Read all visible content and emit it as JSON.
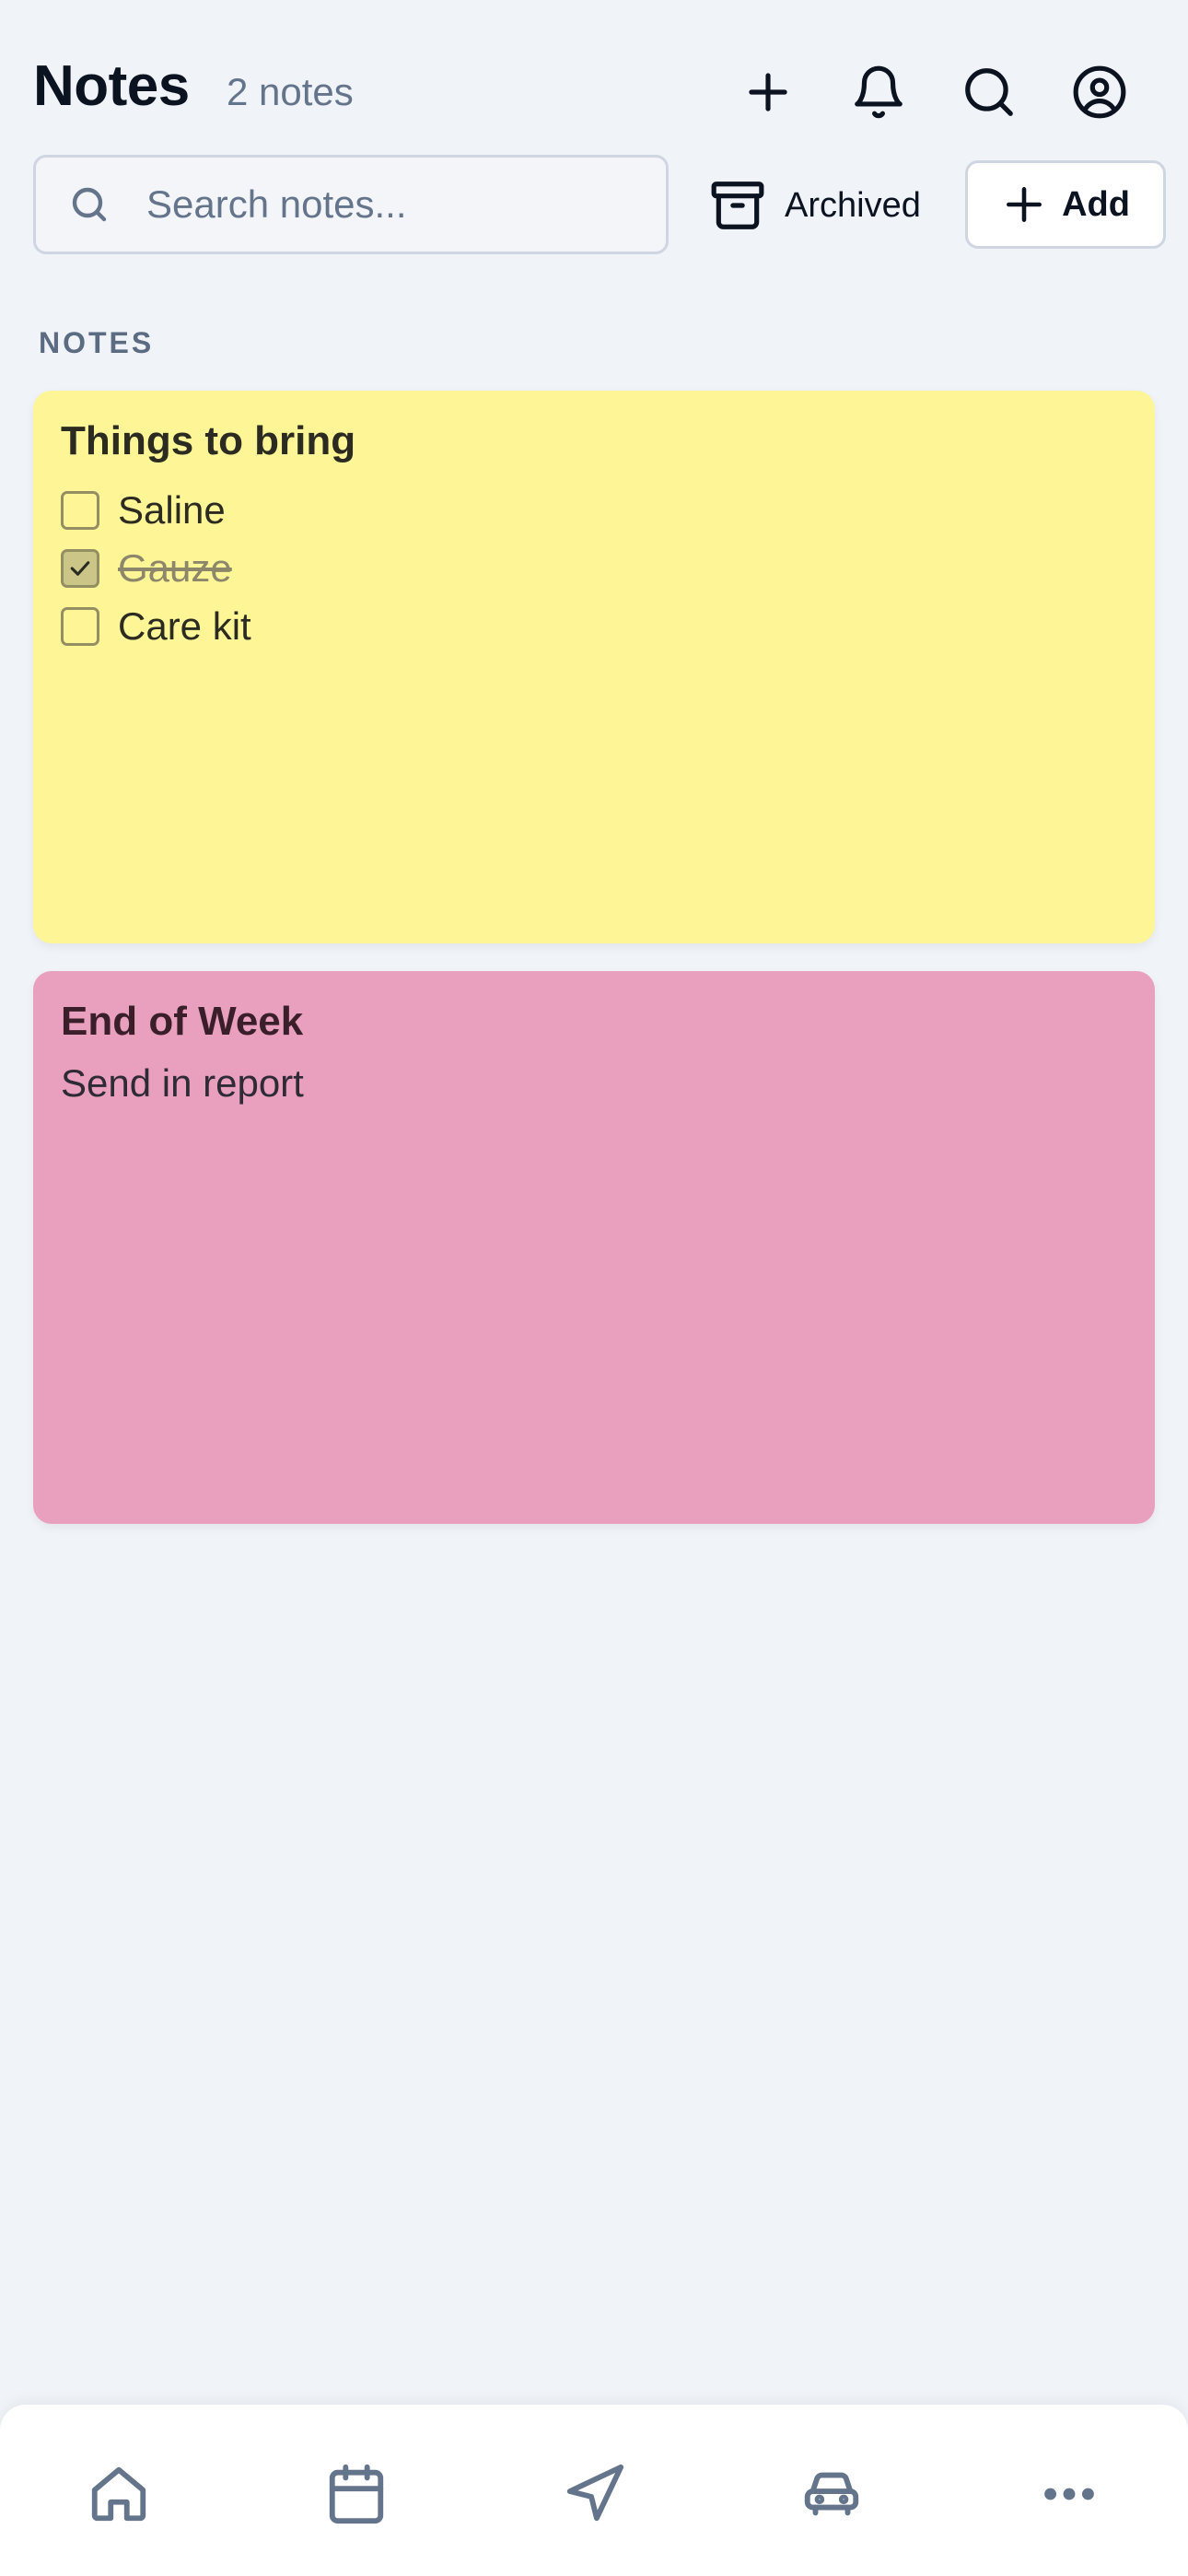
{
  "header": {
    "title": "Notes",
    "count": "2 notes",
    "icons": [
      "plus-icon",
      "bell-icon",
      "search-icon",
      "user-circle-icon"
    ]
  },
  "search": {
    "placeholder": "Search notes..."
  },
  "toolbar": {
    "archived_label": "Archived",
    "add_label": "Add"
  },
  "section": {
    "label": "NOTES"
  },
  "notes": [
    {
      "title": "Things to bring",
      "color": "#fef597",
      "items": [
        {
          "label": "Saline",
          "checked": false
        },
        {
          "label": "Gauze",
          "checked": true
        },
        {
          "label": "Care kit",
          "checked": false
        }
      ]
    },
    {
      "title": "End of Week",
      "color": "#e8a0be",
      "body": "Send in report"
    }
  ],
  "tabbar": {
    "icons": [
      "home-icon",
      "calendar-icon",
      "navigation-icon",
      "car-icon",
      "more-icon"
    ]
  }
}
